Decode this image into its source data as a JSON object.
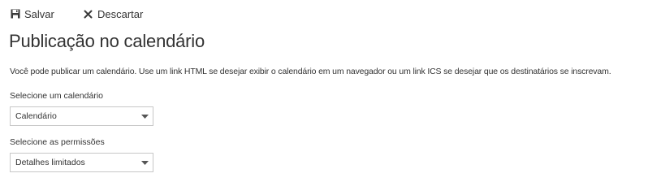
{
  "toolbar": {
    "save_label": "Salvar",
    "save_icon": "save-icon",
    "discard_label": "Descartar",
    "discard_icon": "close-icon"
  },
  "page": {
    "title": "Publicação no calendário",
    "description": "Você pode publicar um calendário. Use um link HTML se desejar exibir o calendário em um navegador ou um link ICS se desejar que os destinatários se inscrevam."
  },
  "form": {
    "calendar": {
      "label": "Selecione um calendário",
      "selected": "Calendário",
      "icon": "chevron-down-icon"
    },
    "permissions": {
      "label": "Selecione as permissões",
      "selected": "Detalhes limitados",
      "icon": "chevron-down-icon"
    }
  },
  "colors": {
    "text": "#333333",
    "border": "#c8c8c8",
    "background": "#ffffff"
  }
}
